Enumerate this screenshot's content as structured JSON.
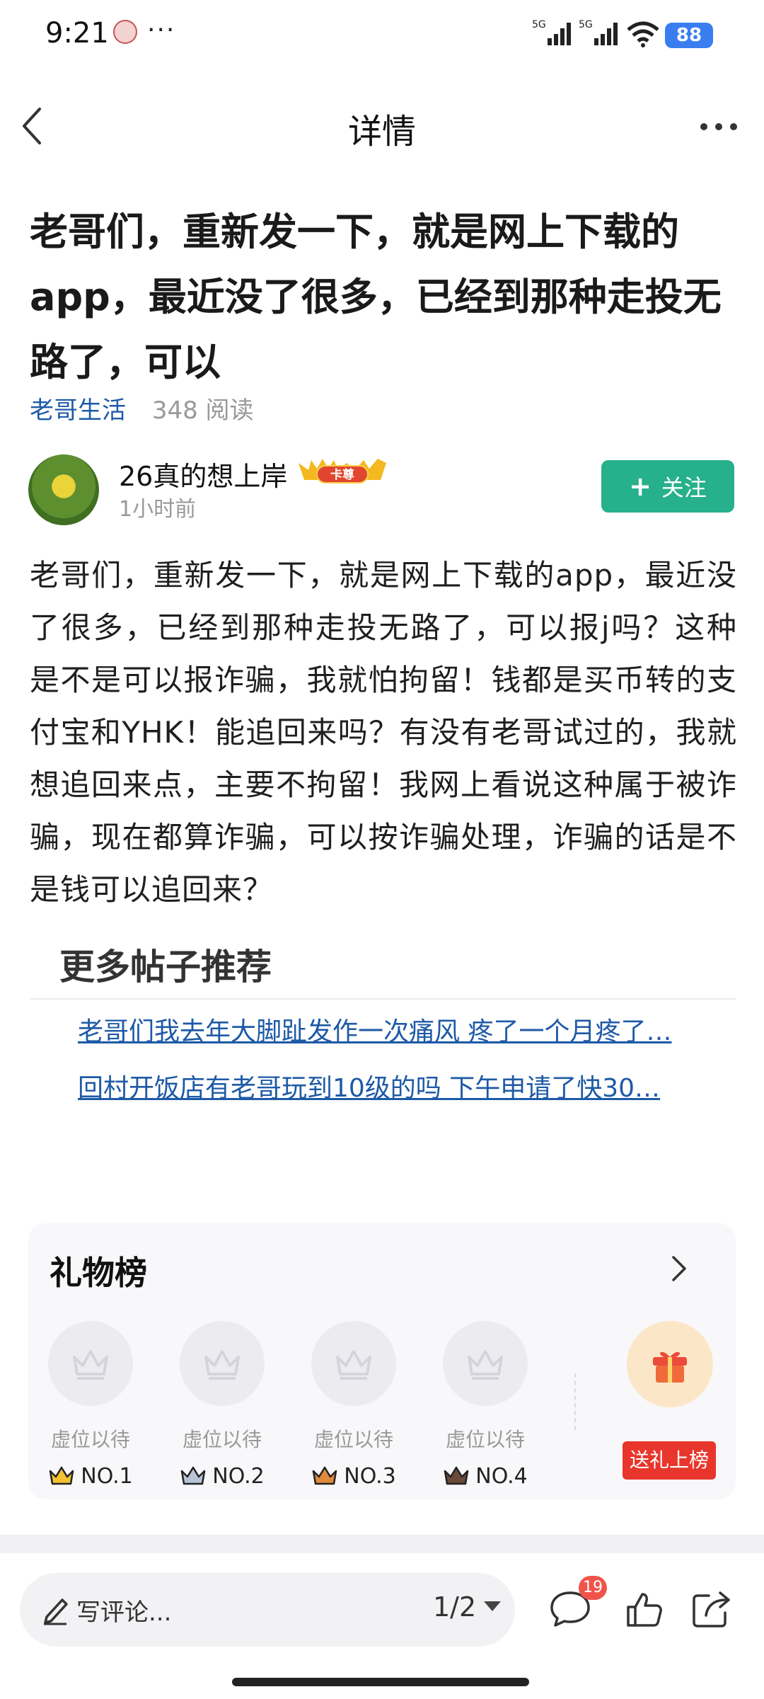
{
  "status_bar": {
    "time": "9:21",
    "dots": "···",
    "signal1_label": "5G",
    "signal2_label": "5G",
    "battery": "88"
  },
  "nav": {
    "title": "详情",
    "back_icon": "chevron-left-icon",
    "more_icon": "more-horizontal-icon"
  },
  "post": {
    "title": "老哥们，重新发一下，就是网上下载的app，最近没了很多，已经到那种走投无路了，可以",
    "category": "老哥生活",
    "reads": "348 阅读",
    "author": {
      "name": "26真的想上岸",
      "badge": "卡尊",
      "time": "1小时前"
    },
    "follow_label": "关注",
    "body": "老哥们，重新发一下，就是网上下载的app，最近没了很多，已经到那种走投无路了，可以报j吗？这种是不是可以报诈骗，我就怕拘留！钱都是买币转的支付宝和YHK！能追回来吗？有没有老哥试过的，我就想追回来点，主要不拘留！我网上看说这种属于被诈骗，现在都算诈骗，可以按诈骗处理，诈骗的话是不是钱可以追回来？"
  },
  "more_posts": {
    "heading": "更多帖子推荐",
    "items": [
      "老哥们我去年大脚趾发作一次痛风 疼了一个月疼了…",
      "回村开饭店有老哥玩到10级的吗 下午申请了快30…"
    ]
  },
  "gift_rank": {
    "title": "礼物榜",
    "slots": [
      {
        "label": "虚位以待",
        "rank": "NO.1",
        "crown_color": "#f2c230"
      },
      {
        "label": "虚位以待",
        "rank": "NO.2",
        "crown_color": "#b8c4d6"
      },
      {
        "label": "虚位以待",
        "rank": "NO.3",
        "crown_color": "#e08a3c"
      },
      {
        "label": "虚位以待",
        "rank": "NO.4",
        "crown_color": "#6b4a3a"
      }
    ],
    "send_button": "送礼上榜"
  },
  "bottom_bar": {
    "comment_placeholder": "写评论...",
    "page_indicator": "1/2",
    "comment_count": "19"
  },
  "colors": {
    "accent_green": "#27b08c",
    "link_blue": "#1e5aa6",
    "red": "#e8362c"
  }
}
